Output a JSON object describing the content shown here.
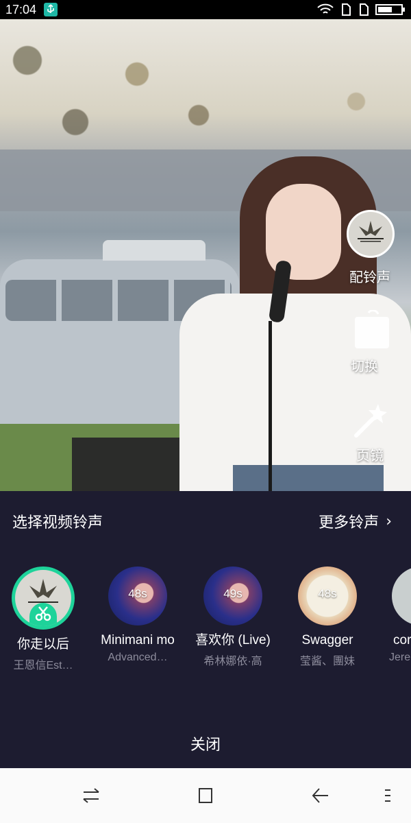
{
  "status_bar": {
    "time": "17:04",
    "icons": [
      "usb-icon",
      "wifi-icon",
      "sim1-icon",
      "sim2-icon",
      "battery-icon"
    ]
  },
  "video_overlay": {
    "ringtone_label": "配铃声",
    "switch_label": "切换",
    "effect_label": "页镜"
  },
  "sheet": {
    "title": "选择视频铃声",
    "more_label": "更多铃声",
    "more_chevron": "›",
    "close_label": "关闭",
    "tracks": [
      {
        "title": "你走以后",
        "artist": "王恩信Est…",
        "duration": "",
        "selected": true
      },
      {
        "title": "Minimani mo",
        "artist": "Advanced…",
        "duration": "48s",
        "selected": false
      },
      {
        "title": "喜欢你 (Live)",
        "artist": "希林娜依·高",
        "duration": "49s",
        "selected": false
      },
      {
        "title": "Swagger",
        "artist": "莹酱、團妹",
        "duration": "48s",
        "selected": false
      },
      {
        "title": "cor",
        "artist": "Jere",
        "duration": "",
        "selected": false
      }
    ]
  },
  "nav_bar": {
    "buttons": [
      "switch-apps-icon",
      "home-icon",
      "back-icon",
      "menu-icon"
    ]
  },
  "colors": {
    "sheet_bg": "#1d1c30",
    "accent_green": "#1ed39a",
    "artist_grey": "#8d8c9c"
  }
}
